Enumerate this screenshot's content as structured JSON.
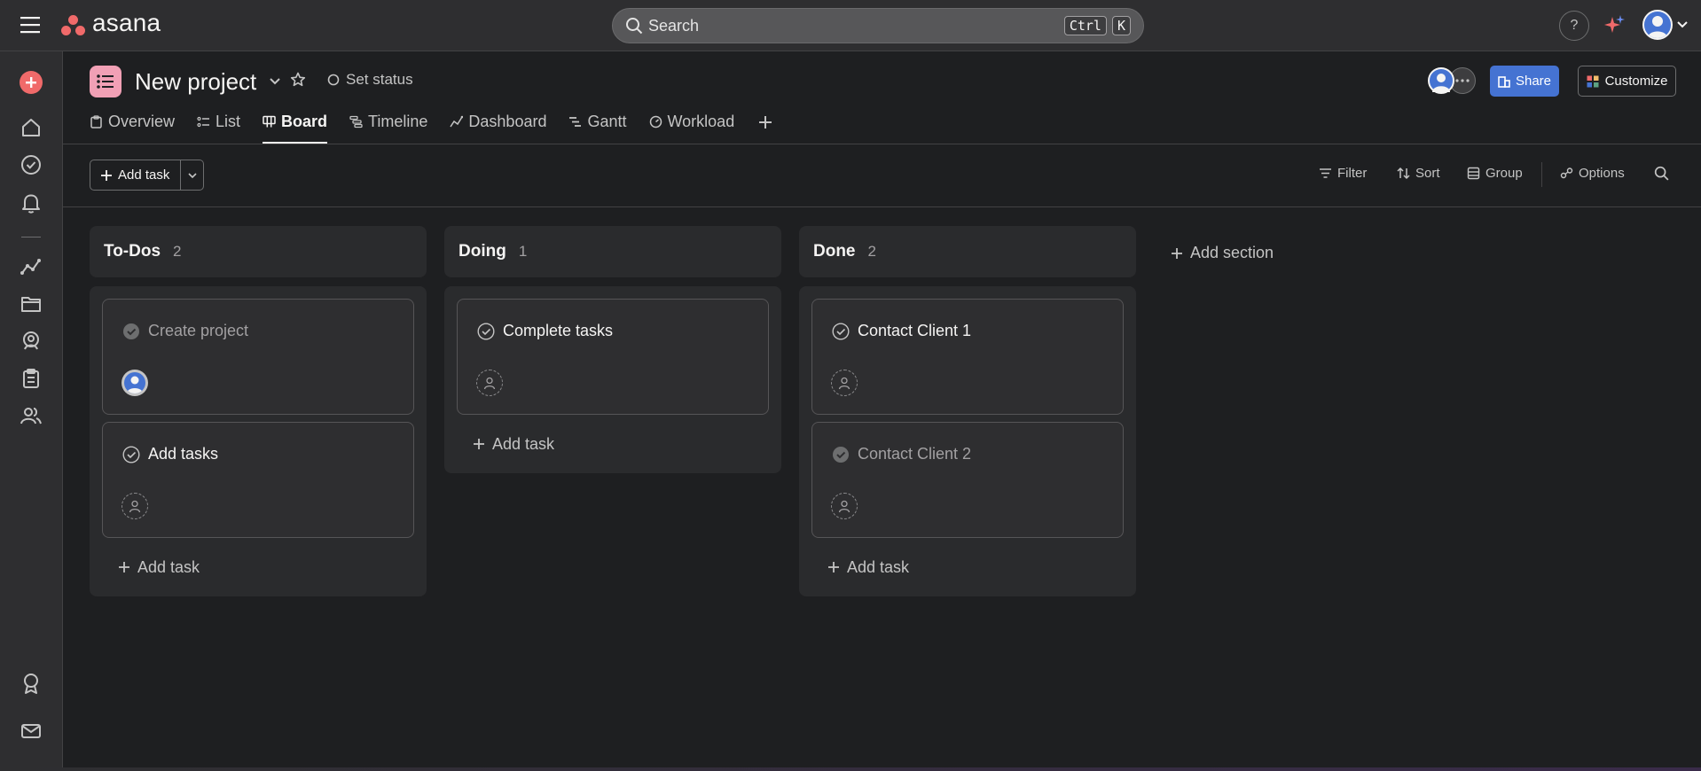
{
  "app": {
    "logo_text": "asana",
    "brand_color": "#f06a6a",
    "accent_color": "#4573d2"
  },
  "topbar": {
    "search_placeholder": "Search",
    "shortcut_key1": "Ctrl",
    "shortcut_key2": "K",
    "help_label": "?"
  },
  "sidebar": {
    "icons": [
      "create-icon",
      "home-icon",
      "my-tasks-icon",
      "inbox-icon",
      "reporting-icon",
      "portfolios-icon",
      "goals-icon",
      "projects-icon",
      "teams-icon",
      "achievements-icon",
      "invite-mail-icon"
    ]
  },
  "project": {
    "title": "New project",
    "set_status_label": "Set status",
    "share_label": "Share",
    "customize_label": "Customize",
    "icon_color": "#f1a0b5"
  },
  "tabs": [
    {
      "label": "Overview",
      "active": false
    },
    {
      "label": "List",
      "active": false
    },
    {
      "label": "Board",
      "active": true
    },
    {
      "label": "Timeline",
      "active": false
    },
    {
      "label": "Dashboard",
      "active": false
    },
    {
      "label": "Gantt",
      "active": false
    },
    {
      "label": "Workload",
      "active": false
    }
  ],
  "toolbar": {
    "add_task_label": "Add task",
    "filter_label": "Filter",
    "sort_label": "Sort",
    "group_label": "Group",
    "options_label": "Options"
  },
  "board": {
    "columns": [
      {
        "name": "To-Dos",
        "count": "2",
        "cards": [
          {
            "name": "Create project",
            "completed": true,
            "assigned": true
          },
          {
            "name": "Add tasks",
            "completed": false,
            "assigned": false
          }
        ],
        "add_task_label": "Add task"
      },
      {
        "name": "Doing",
        "count": "1",
        "cards": [
          {
            "name": "Complete tasks",
            "completed": false,
            "assigned": false
          }
        ],
        "add_task_label": "Add task"
      },
      {
        "name": "Done",
        "count": "2",
        "cards": [
          {
            "name": "Contact Client 1",
            "completed": false,
            "assigned": false
          },
          {
            "name": "Contact Client 2",
            "completed": true,
            "assigned": false
          }
        ],
        "add_task_label": "Add task"
      }
    ],
    "add_section_label": "Add section"
  }
}
